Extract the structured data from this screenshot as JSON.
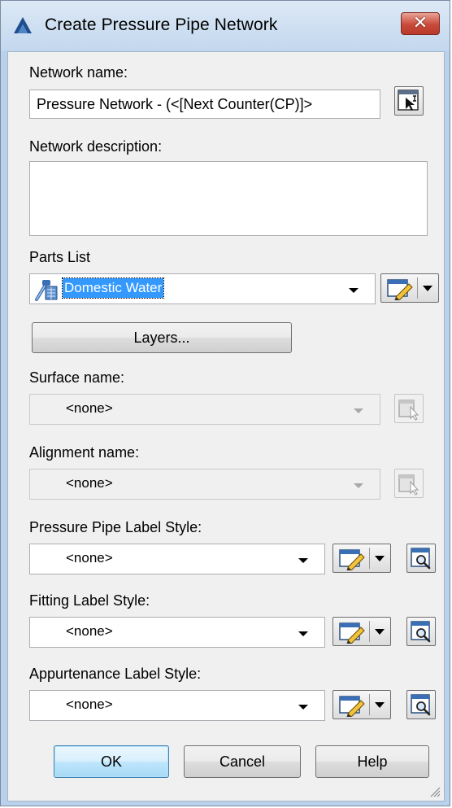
{
  "window": {
    "title": "Create Pressure Pipe Network",
    "close_label": "✕"
  },
  "network_name": {
    "label": "Network name:",
    "value": "Pressure Network - (<[Next Counter(CP)]>"
  },
  "network_description": {
    "label": "Network description:",
    "value": ""
  },
  "parts_list": {
    "label": "Parts List",
    "value": "Domestic Water",
    "layers_button": "Layers..."
  },
  "surface": {
    "label": "Surface name:",
    "value": "<none>"
  },
  "alignment": {
    "label": "Alignment name:",
    "value": "<none>"
  },
  "pipe_label_style": {
    "label": "Pressure Pipe Label Style:",
    "value": "<none>"
  },
  "fitting_label_style": {
    "label": "Fitting Label Style:",
    "value": "<none>"
  },
  "appurtenance_label_style": {
    "label": "Appurtenance Label Style:",
    "value": "<none>"
  },
  "buttons": {
    "ok": "OK",
    "cancel": "Cancel",
    "help": "Help"
  },
  "colors": {
    "title_bar": "#c2d7ee",
    "close_button": "#c94a3a",
    "selection": "#3399ff"
  }
}
